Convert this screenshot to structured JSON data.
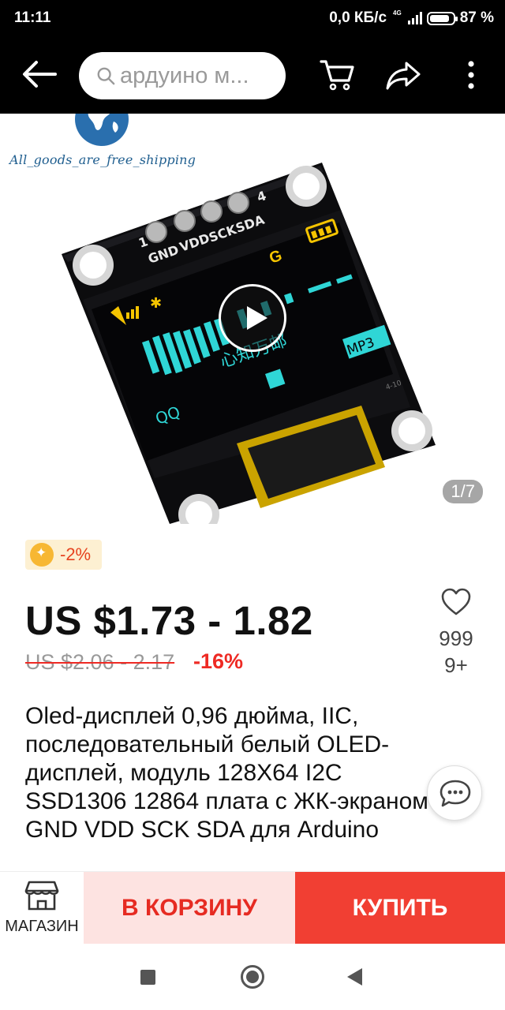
{
  "status_bar": {
    "time": "11:11",
    "network_speed": "0,0 КБ/с",
    "network_type": "4G",
    "battery_percent": "87 %",
    "battery_level": 0.87
  },
  "app_bar": {
    "search_placeholder": "ардуино м...",
    "icons": [
      "back-arrow-icon",
      "search-icon",
      "cart-icon",
      "share-icon",
      "more-vert-icon"
    ]
  },
  "gallery": {
    "brand_text": "All_goods_are_free_shipping",
    "counter": "1/7",
    "product_image": {
      "pin_labels": [
        "GND",
        "VDD",
        "SCK",
        "SDA"
      ],
      "pin_numbers": [
        "1",
        "4"
      ],
      "screen_badge": "MP3",
      "screen_text": "QQ",
      "board_code": "4-10",
      "screen_chinese": "心知万邮"
    }
  },
  "product": {
    "discount_badge": "-2%",
    "price": "US $1.73 - 1.82",
    "old_price": "US $2.06 - 2.17",
    "discount_percent": "-16%",
    "wishlist_count_line1": "999",
    "wishlist_count_line2": "9+",
    "title": "Oled-дисплей 0,96 дюйма, IIC, последовательный белый OLED-дисплей, модуль 128X64 I2C SSD1306 12864 плата с ЖК-экраном GND VDD SCK SDA для Arduino"
  },
  "action_bar": {
    "store_label": "МАГАЗИН",
    "add_to_cart": "В КОРЗИНУ",
    "buy_now": "КУПИТЬ"
  },
  "colors": {
    "accent_red": "#f13f33",
    "cart_bg": "#fde3e1",
    "price_red": "#ee2a24",
    "oled_cyan": "#2fd6d6",
    "oled_yellow": "#f5c400"
  }
}
